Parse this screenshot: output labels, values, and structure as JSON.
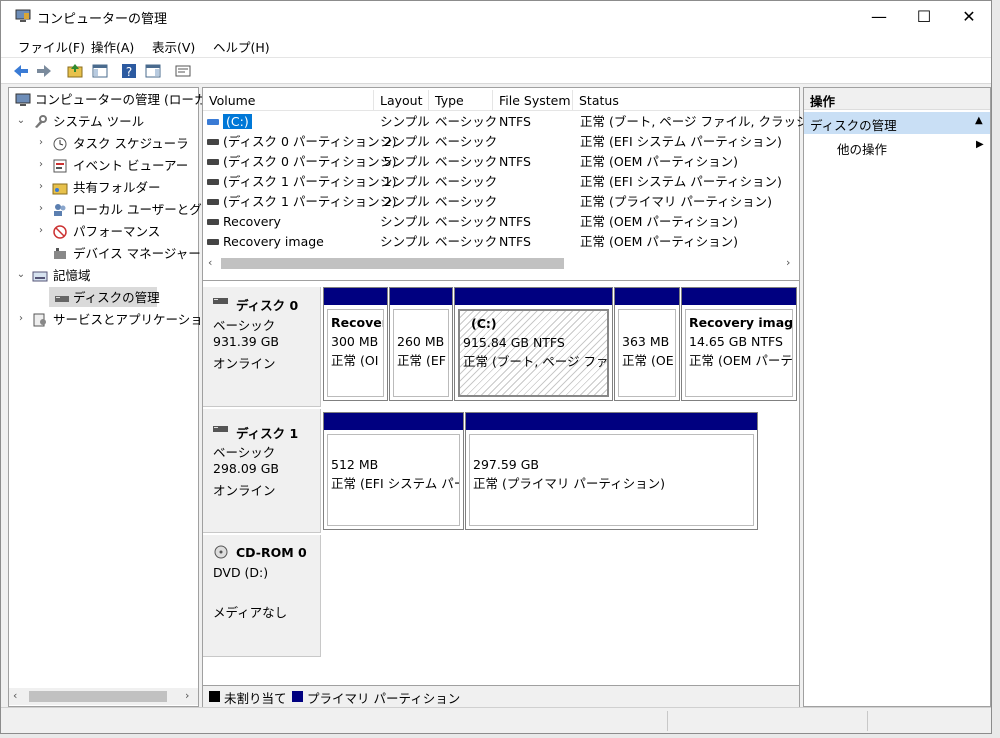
{
  "window": {
    "title": "コンピューターの管理",
    "minimize": "—",
    "maximize": "☐",
    "close": "✕"
  },
  "menu": [
    "ファイル(F)",
    "操作(A)",
    "表示(V)",
    "ヘルプ(H)"
  ],
  "tree": {
    "root": "コンピューターの管理 (ローカル)",
    "system_tools": "システム ツール",
    "task_scheduler": "タスク スケジューラ",
    "event_viewer": "イベント ビューアー",
    "shared_folders": "共有フォルダー",
    "local_users": "ローカル ユーザーとグル-",
    "performance": "パフォーマンス",
    "device_manager": "デバイス マネージャー",
    "storage": "記憶域",
    "disk_management": "ディスクの管理",
    "services_apps": "サービスとアプリケーション"
  },
  "volume_list": {
    "columns": [
      "Volume",
      "Layout",
      "Type",
      "File System",
      "Status"
    ],
    "rows": [
      {
        "volume": "(C:)",
        "layout": "シンプル",
        "type": "ベーシック",
        "fs": "NTFS",
        "status": "正常 (ブート, ページ ファイル, クラッシュ ダ"
      },
      {
        "volume": "(ディスク 0 パーティション 2)",
        "layout": "シンプル",
        "type": "ベーシック",
        "fs": "",
        "status": "正常 (EFI システム パーティション)"
      },
      {
        "volume": "(ディスク 0 パーティション 5)",
        "layout": "シンプル",
        "type": "ベーシック",
        "fs": "NTFS",
        "status": "正常 (OEM パーティション)"
      },
      {
        "volume": "(ディスク 1 パーティション 1)",
        "layout": "シンプル",
        "type": "ベーシック",
        "fs": "",
        "status": "正常 (EFI システム パーティション)"
      },
      {
        "volume": "(ディスク 1 パーティション 2)",
        "layout": "シンプル",
        "type": "ベーシック",
        "fs": "",
        "status": "正常 (プライマリ パーティション)"
      },
      {
        "volume": "Recovery",
        "layout": "シンプル",
        "type": "ベーシック",
        "fs": "NTFS",
        "status": "正常 (OEM パーティション)"
      },
      {
        "volume": "Recovery image",
        "layout": "シンプル",
        "type": "ベーシック",
        "fs": "NTFS",
        "status": "正常 (OEM パーティション)"
      }
    ]
  },
  "disks": {
    "disk0": {
      "name": "ディスク 0",
      "type": "ベーシック",
      "size": "931.39 GB",
      "state": "オンライン",
      "partitions": [
        {
          "title": "Recover",
          "size": "300 MB",
          "status": "正常 (OI"
        },
        {
          "title": "",
          "size": "260 MB",
          "status": "正常 (EF"
        },
        {
          "title": "(C:)",
          "size": "915.84 GB NTFS",
          "status": "正常 (ブート, ページ ファイル"
        },
        {
          "title": "",
          "size": "363 MB",
          "status": "正常 (OE"
        },
        {
          "title": "Recovery image",
          "size": "14.65 GB NTFS",
          "status": "正常 (OEM パーテ"
        }
      ]
    },
    "disk1": {
      "name": "ディスク 1",
      "type": "ベーシック",
      "size": "298.09 GB",
      "state": "オンライン",
      "partitions": [
        {
          "size": "512 MB",
          "status": "正常 (EFI システム パー"
        },
        {
          "size": "297.59 GB",
          "status": "正常 (プライマリ パーティション)"
        }
      ]
    },
    "cdrom": {
      "name": "CD-ROM 0",
      "drive": "DVD (D:)",
      "media": "メディアなし"
    }
  },
  "legend": {
    "unallocated": "未割り当て",
    "primary": "プライマリ パーティション"
  },
  "actions": {
    "header": "操作",
    "section": "ディスクの管理",
    "more": "他の操作"
  },
  "colors": {
    "partition_bar": "#000080",
    "selection": "#0078d7"
  }
}
